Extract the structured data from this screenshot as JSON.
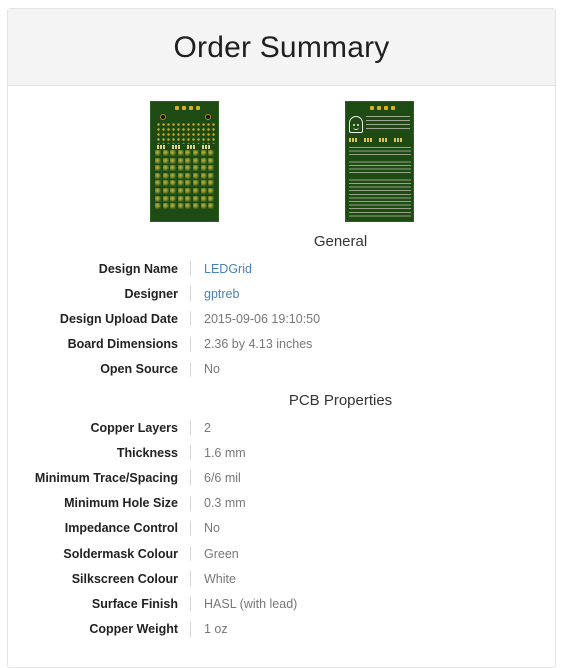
{
  "header": {
    "title": "Order Summary"
  },
  "images": {
    "front_alt": "PCB front render",
    "back_alt": "PCB back render"
  },
  "colors": {
    "link": "#4a80b8",
    "pcb_green": "#1e4a14",
    "header_bg": "#f4f4f4"
  },
  "sections": [
    {
      "title": "General",
      "rows": [
        {
          "label": "Design Name",
          "value": "LEDGrid",
          "link": true
        },
        {
          "label": "Designer",
          "value": "gptreb",
          "link": true
        },
        {
          "label": "Design Upload Date",
          "value": "2015-09-06 19:10:50",
          "link": false
        },
        {
          "label": "Board Dimensions",
          "value": "2.36 by 4.13 inches",
          "link": false
        },
        {
          "label": "Open Source",
          "value": "No",
          "link": false
        }
      ]
    },
    {
      "title": "PCB Properties",
      "rows": [
        {
          "label": "Copper Layers",
          "value": "2",
          "link": false
        },
        {
          "label": "Thickness",
          "value": "1.6 mm",
          "link": false
        },
        {
          "label": "Minimum Trace/Spacing",
          "value": "6/6 mil",
          "link": false
        },
        {
          "label": "Minimum Hole Size",
          "value": "0.3 mm",
          "link": false
        },
        {
          "label": "Impedance Control",
          "value": "No",
          "link": false
        },
        {
          "label": "Soldermask Colour",
          "value": "Green",
          "link": false
        },
        {
          "label": "Silkscreen Colour",
          "value": "White",
          "link": false
        },
        {
          "label": "Surface Finish",
          "value": "HASL (with lead)",
          "link": false
        },
        {
          "label": "Copper Weight",
          "value": "1 oz",
          "link": false
        }
      ]
    }
  ]
}
